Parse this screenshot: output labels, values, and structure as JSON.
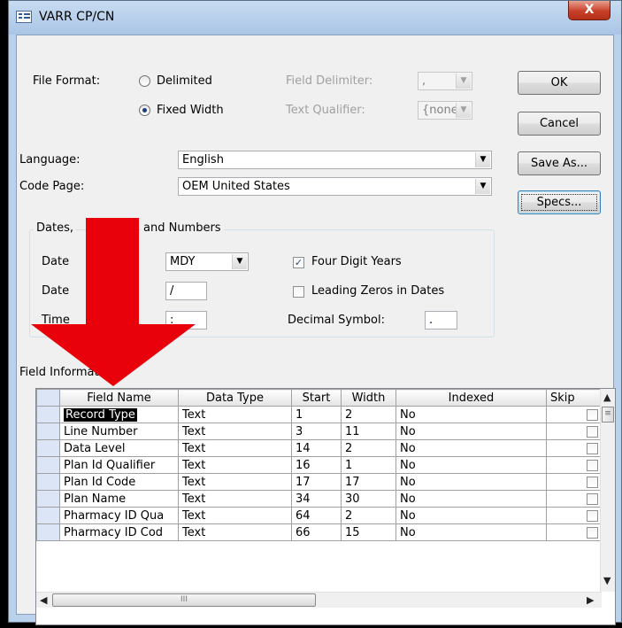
{
  "window": {
    "title": "VARR CP/CN",
    "close_glyph": "X",
    "icon": "table-window-icon"
  },
  "file_format": {
    "label": "File Format:",
    "delimited_label": "Delimited",
    "fixed_width_label": "Fixed Width",
    "selected": "Fixed Width",
    "field_delimiter_label": "Field Delimiter:",
    "field_delimiter_value": ",",
    "text_qualifier_label": "Text Qualifier:",
    "text_qualifier_value": "{none}"
  },
  "buttons": {
    "ok": "OK",
    "cancel": "Cancel",
    "save_as": "Save As...",
    "specs": "Specs..."
  },
  "language": {
    "label": "Language:",
    "value": "English"
  },
  "code_page": {
    "label": "Code Page:",
    "value": "OEM United States"
  },
  "dates_group": {
    "label_part1": "Dates,",
    "label_part2": "and Numbers",
    "date_order_label": "Date",
    "date_order_value": "MDY",
    "date_delimiter_label": "Date",
    "date_delimiter_value": "/",
    "time_delimiter_label": "Time",
    "time_delimiter_value": ":",
    "four_digit_years_label": "Four Digit Years",
    "four_digit_years_checked": true,
    "leading_zeros_label": "Leading Zeros in Dates",
    "leading_zeros_checked": false,
    "decimal_symbol_label": "Decimal Symbol:",
    "decimal_symbol_value": "."
  },
  "field_info": {
    "label": "Field Information:",
    "columns": [
      "Field Name",
      "Data Type",
      "Start",
      "Width",
      "Indexed",
      "Skip"
    ],
    "rows": [
      {
        "name": "Record Type",
        "type": "Text",
        "start": "1",
        "width": "2",
        "indexed": "No"
      },
      {
        "name": "Line Number",
        "type": "Text",
        "start": "3",
        "width": "11",
        "indexed": "No"
      },
      {
        "name": "Data Level",
        "type": "Text",
        "start": "14",
        "width": "2",
        "indexed": "No"
      },
      {
        "name": "Plan Id Qualifier",
        "type": "Text",
        "start": "16",
        "width": "1",
        "indexed": "No"
      },
      {
        "name": "Plan Id Code",
        "type": "Text",
        "start": "17",
        "width": "17",
        "indexed": "No"
      },
      {
        "name": "Plan Name",
        "type": "Text",
        "start": "34",
        "width": "30",
        "indexed": "No"
      },
      {
        "name": "Pharmacy ID Qua",
        "type": "Text",
        "start": "64",
        "width": "2",
        "indexed": "No"
      },
      {
        "name": "Pharmacy ID Cod",
        "type": "Text",
        "start": "66",
        "width": "15",
        "indexed": "No"
      }
    ],
    "selected_row": 0
  },
  "annotation": {
    "arrow_color": "#e8000b"
  }
}
